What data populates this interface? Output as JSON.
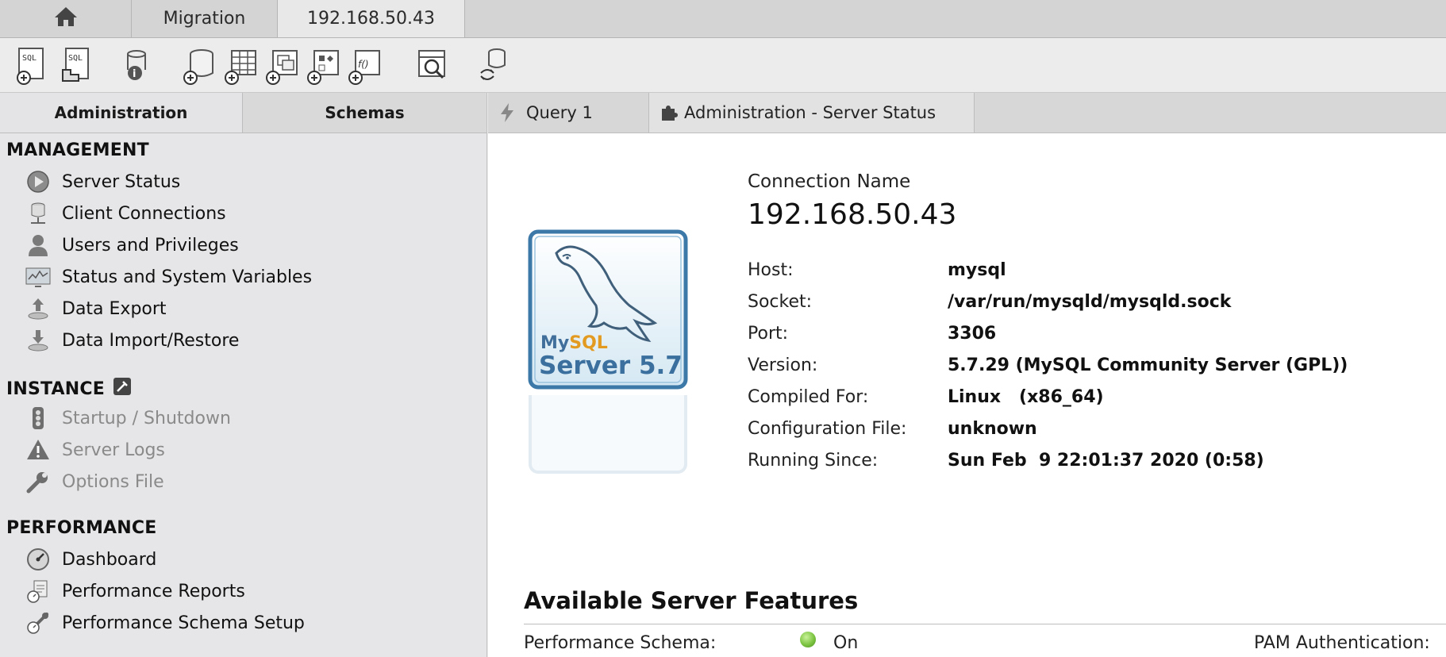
{
  "top_tabs": {
    "home_icon": "home-icon",
    "migration": "Migration",
    "connection": "192.168.50.43"
  },
  "toolbar": {
    "icons": [
      "new-sql-tab-icon",
      "open-sql-script-icon",
      "inspector-icon",
      "create-schema-icon",
      "create-table-icon",
      "create-view-icon",
      "create-procedure-icon",
      "create-function-icon",
      "search-table-data-icon",
      "reconnect-icon"
    ]
  },
  "sidebar": {
    "tabs": {
      "administration": "Administration",
      "schemas": "Schemas"
    },
    "management": {
      "title": "MANAGEMENT",
      "items": [
        {
          "label": "Server Status",
          "icon": "play-icon"
        },
        {
          "label": "Client Connections",
          "icon": "database-connections-icon"
        },
        {
          "label": "Users and Privileges",
          "icon": "user-icon"
        },
        {
          "label": "Status and System Variables",
          "icon": "monitor-icon"
        },
        {
          "label": "Data Export",
          "icon": "export-icon"
        },
        {
          "label": "Data Import/Restore",
          "icon": "import-icon"
        }
      ]
    },
    "instance": {
      "title": "INSTANCE",
      "items": [
        {
          "label": "Startup / Shutdown",
          "icon": "traffic-light-icon"
        },
        {
          "label": "Server Logs",
          "icon": "warning-icon"
        },
        {
          "label": "Options File",
          "icon": "wrench-icon"
        }
      ]
    },
    "performance": {
      "title": "PERFORMANCE",
      "items": [
        {
          "label": "Dashboard",
          "icon": "gauge-icon"
        },
        {
          "label": "Performance Reports",
          "icon": "reports-icon"
        },
        {
          "label": "Performance Schema Setup",
          "icon": "schema-setup-icon"
        }
      ]
    }
  },
  "editor_tabs": {
    "query": "Query 1",
    "admin": "Administration - Server Status"
  },
  "server": {
    "logo_text": {
      "brand": "MySQL",
      "product": "Server 5.7"
    },
    "connection_name_label": "Connection Name",
    "connection_name": "192.168.50.43",
    "rows": [
      {
        "key": "Host:",
        "value": "mysql"
      },
      {
        "key": "Socket:",
        "value": "/var/run/mysqld/mysqld.sock"
      },
      {
        "key": "Port:",
        "value": "3306"
      },
      {
        "key": "Version:",
        "value": "5.7.29 (MySQL Community Server (GPL))"
      },
      {
        "key": "Compiled For:",
        "value": "Linux   (x86_64)"
      },
      {
        "key": "Configuration File:",
        "value": "unknown"
      },
      {
        "key": "Running Since:",
        "value": "Sun Feb  9 22:01:37 2020 (0:58)"
      }
    ]
  },
  "features": {
    "title": "Available Server Features",
    "performance_schema_label": "Performance Schema:",
    "performance_schema_value": "On",
    "pam_label": "PAM Authentication:",
    "status_color": "#7cc441"
  }
}
